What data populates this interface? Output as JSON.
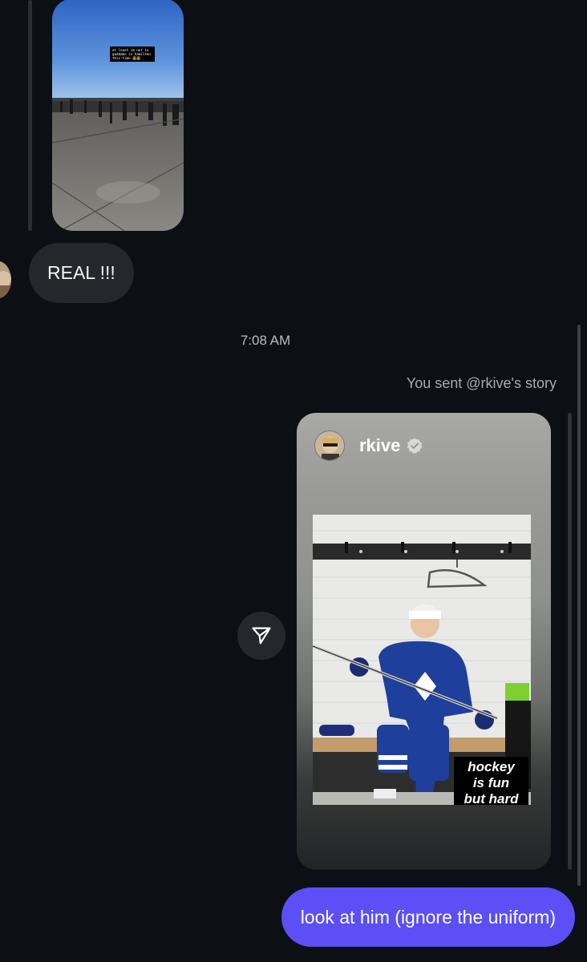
{
  "thread": {
    "story_thumbnail": {
      "caption_lines": [
        "at least im not in",
        "goddamn in hamilton",
        "this time 😎😎"
      ]
    },
    "received_message": {
      "text": "REAL !!!"
    },
    "timestamp": "7:08 AM",
    "sent_story": {
      "label": "You sent @rkive's story",
      "username": "rkive",
      "verified": true,
      "sticker_lines": [
        "hockey",
        "is fun",
        "but hard"
      ]
    },
    "sent_message": {
      "text": "look at him (ignore the uniform)"
    }
  },
  "colors": {
    "background": "#0c0f14",
    "received_bubble": "#24272c",
    "sent_bubble": "#5b4ff5",
    "meta_text": "#a7abb2"
  },
  "icons": {
    "share": "paper-plane-icon",
    "verified": "verified-badge-icon"
  }
}
